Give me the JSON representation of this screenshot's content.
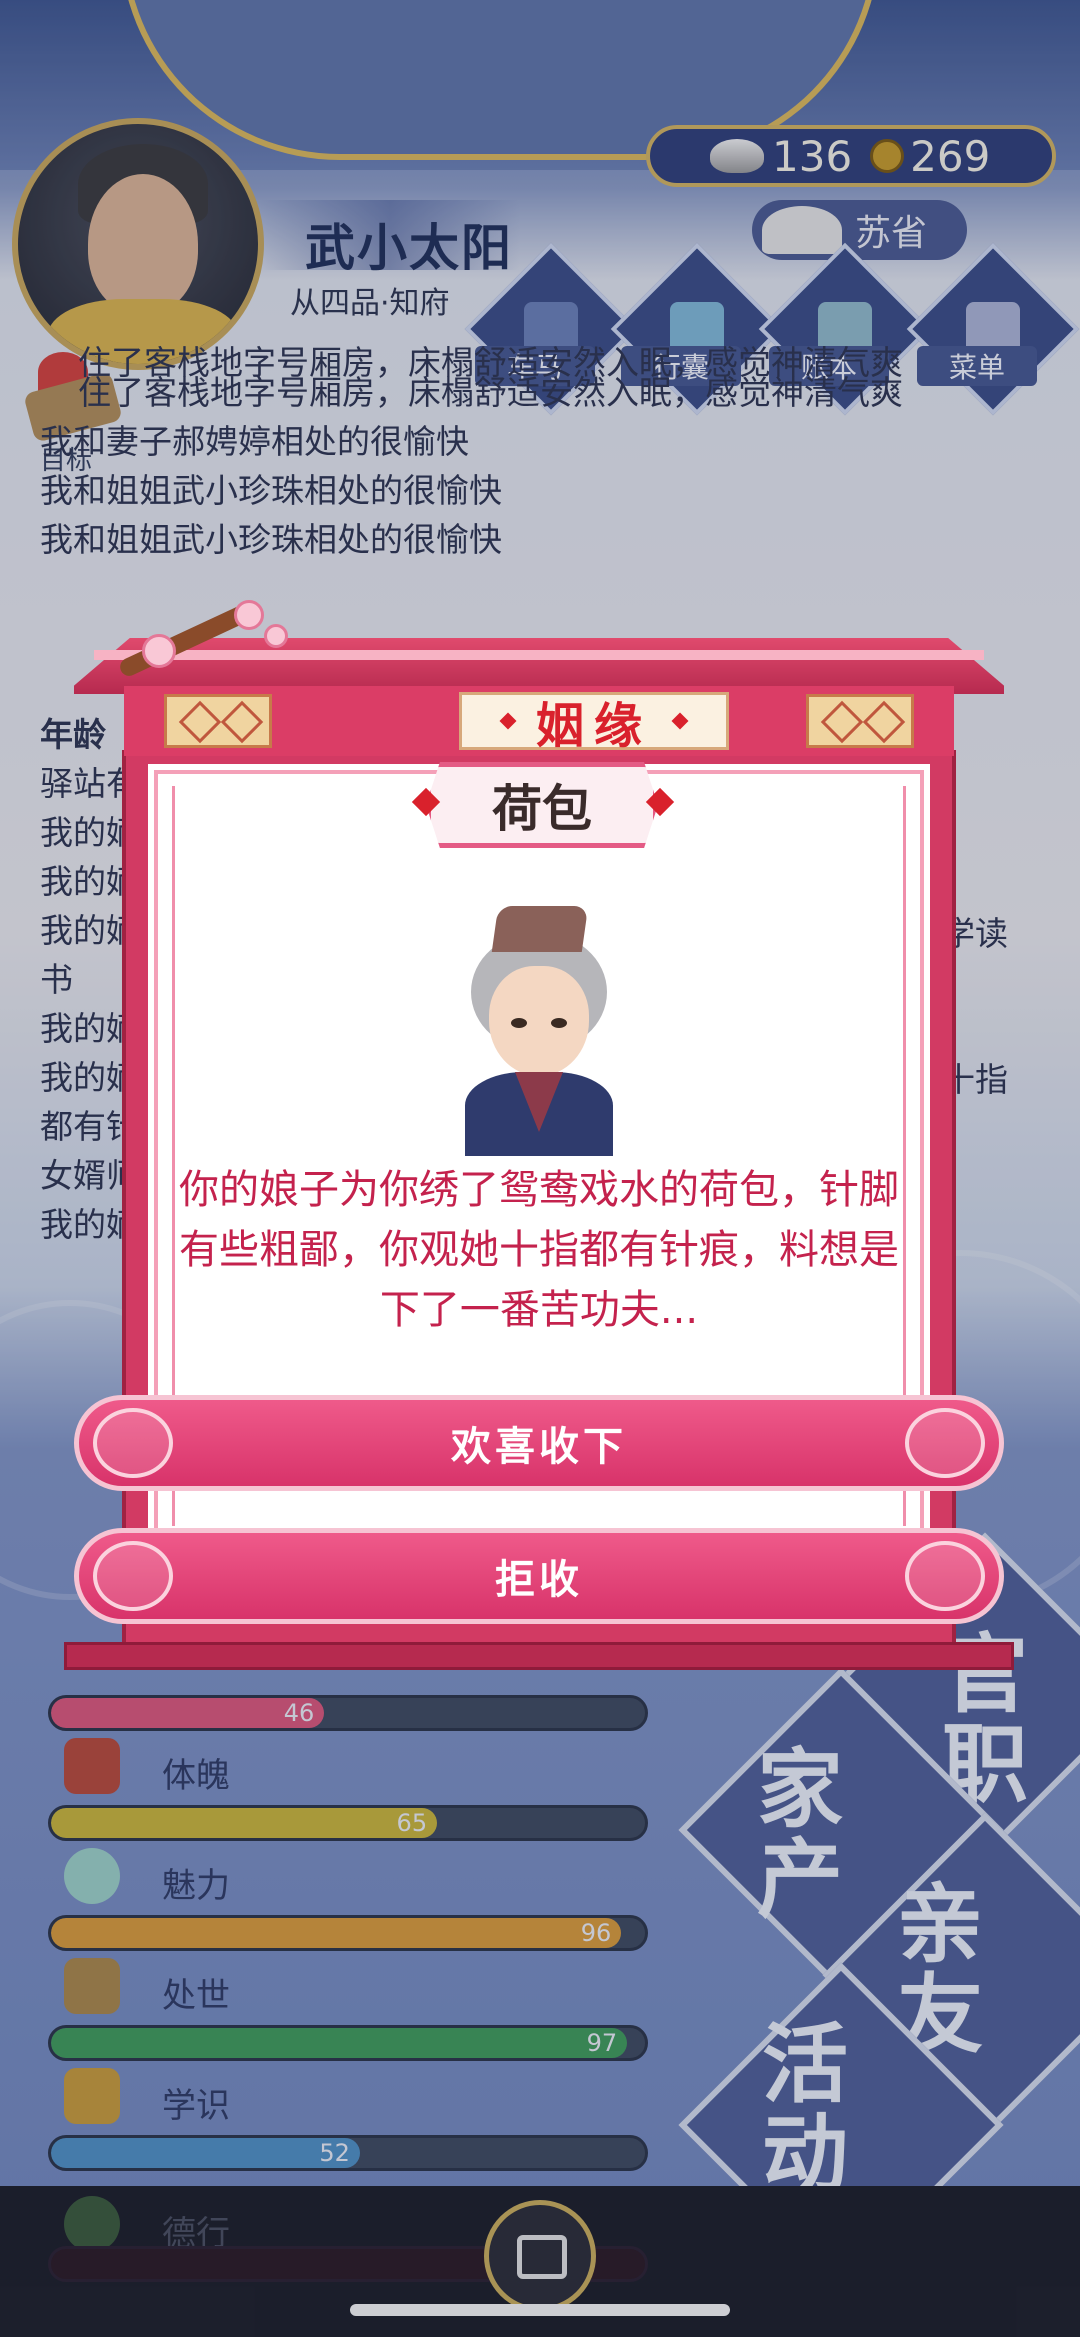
{
  "player": {
    "name": "武小太阳",
    "rank": "从四品·知府",
    "silver": "136",
    "copper": "269",
    "location": "苏省"
  },
  "top_menu": [
    {
      "label": "车马",
      "icon": "carriage-icon"
    },
    {
      "label": "行囊",
      "icon": "bag-icon"
    },
    {
      "label": "账本",
      "icon": "ledger-icon"
    },
    {
      "label": "菜单",
      "icon": "menu-dots-icon"
    }
  ],
  "goal_label": "目标",
  "log": {
    "partial_line": "住了客栈地字号厢房，床榻舒适安然入眠，感觉神清气爽",
    "lines": [
      "住了客栈地字号厢房，床榻舒适安然入眠，感觉神清气爽",
      "我和妻子郝娉婷相处的很愉快",
      "我和姐姐武小珍珠相处的很愉快",
      "我和姐姐武小珍珠相处的很愉快"
    ],
    "age_prefix": "年龄",
    "lines2": [
      "驿站有",
      "我的嫡",
      "我的嫡",
      "我的嫡",
      "书",
      "我的嫡",
      "我的嫡",
      "都有针",
      "女婿师",
      "我的嫡"
    ],
    "right_fragments": [
      "学读",
      "十指"
    ]
  },
  "stats": [
    {
      "label": "",
      "value": 46,
      "max": 100,
      "color": "#d9577a",
      "icon": "heart-icon"
    },
    {
      "label": "体魄",
      "value": 65,
      "max": 100,
      "color": "#c7b43a",
      "icon": "body-icon"
    },
    {
      "label": "魅力",
      "value": 96,
      "max": 100,
      "color": "#d79a3a",
      "icon": "charm-icon"
    },
    {
      "label": "处世",
      "value": 97,
      "max": 100,
      "color": "#3f9a5a",
      "icon": "social-icon"
    },
    {
      "label": "学识",
      "value": 52,
      "max": 100,
      "color": "#4f8fc2",
      "icon": "books-icon"
    },
    {
      "label": "德行",
      "value": 0,
      "max": 100,
      "color": "#7a2a2a",
      "icon": "virtue-icon"
    }
  ],
  "side_buttons": [
    {
      "label": "官职",
      "name": "office-button"
    },
    {
      "label": "家产",
      "name": "estate-button"
    },
    {
      "label": "亲友",
      "name": "relatives-button"
    },
    {
      "label": "活动",
      "name": "activity-button"
    }
  ],
  "modal": {
    "title": "姻缘",
    "item_name": "荷包",
    "story": "你的娘子为你绣了鸳鸯戏水的荷包，针脚有些粗鄙，你观她十指都有针痕，料想是下了一番苦功夫...",
    "accept_label": "欢喜收下",
    "reject_label": "拒收"
  }
}
